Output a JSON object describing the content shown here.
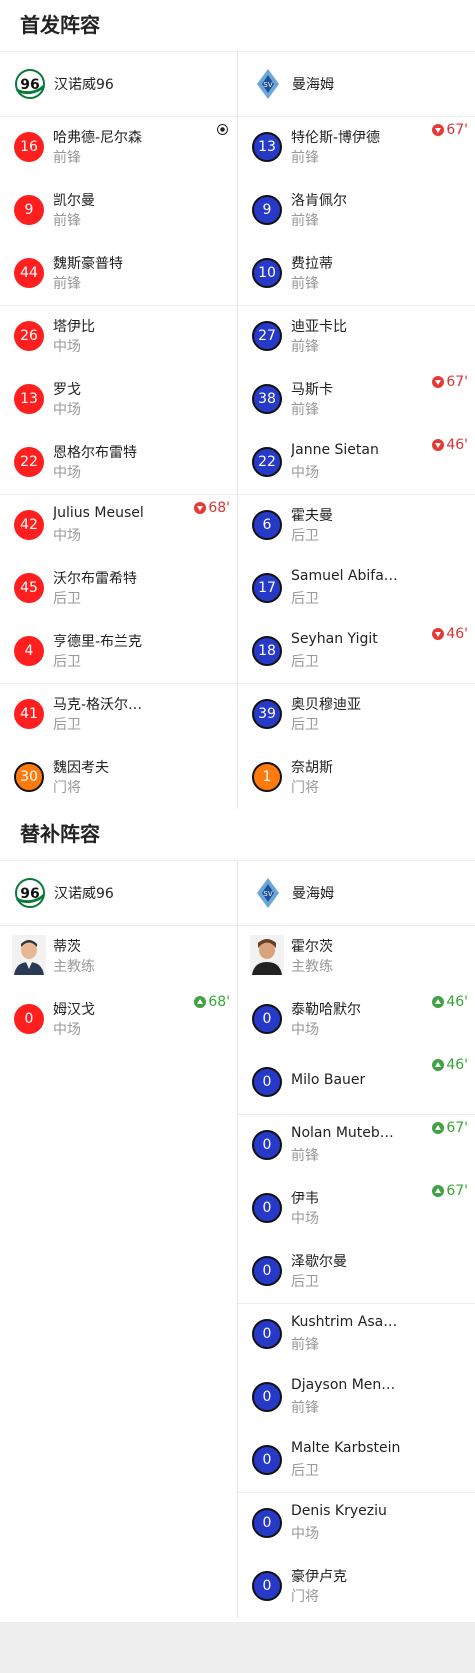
{
  "starting": {
    "title": "首发阵容",
    "home": {
      "name": "汉诺威96",
      "players": [
        {
          "num": "16",
          "name": "哈弗德-尼尔森",
          "pos": "前锋",
          "event": "goal",
          "min": ""
        },
        {
          "num": "9",
          "name": "凯尔曼",
          "pos": "前锋",
          "event": "",
          "min": ""
        },
        {
          "num": "44",
          "name": "魏斯豪普特",
          "pos": "前锋",
          "event": "",
          "min": ""
        },
        {
          "num": "26",
          "name": "塔伊比",
          "pos": "中场",
          "event": "",
          "min": ""
        },
        {
          "num": "13",
          "name": "罗戈",
          "pos": "中场",
          "event": "",
          "min": ""
        },
        {
          "num": "22",
          "name": "恩格尔布雷特",
          "pos": "中场",
          "event": "",
          "min": ""
        },
        {
          "num": "42",
          "name": "Julius Meusel",
          "pos": "中场",
          "event": "out",
          "min": "68'"
        },
        {
          "num": "45",
          "name": "沃尔布雷希特",
          "pos": "后卫",
          "event": "",
          "min": ""
        },
        {
          "num": "4",
          "name": "亨德里-布兰克",
          "pos": "后卫",
          "event": "",
          "min": ""
        },
        {
          "num": "41",
          "name": "马克-格沃尔…",
          "pos": "后卫",
          "event": "",
          "min": ""
        },
        {
          "num": "30",
          "name": "魏因考夫",
          "pos": "门将",
          "event": "",
          "min": ""
        }
      ]
    },
    "away": {
      "name": "曼海姆",
      "players": [
        {
          "num": "13",
          "name": "特伦斯-博伊德",
          "pos": "前锋",
          "event": "out",
          "min": "67'"
        },
        {
          "num": "9",
          "name": "洛肯佩尔",
          "pos": "前锋",
          "event": "",
          "min": ""
        },
        {
          "num": "10",
          "name": "费拉蒂",
          "pos": "前锋",
          "event": "",
          "min": ""
        },
        {
          "num": "27",
          "name": "迪亚卡比",
          "pos": "前锋",
          "event": "",
          "min": ""
        },
        {
          "num": "38",
          "name": "马斯卡",
          "pos": "前锋",
          "event": "out",
          "min": "67'"
        },
        {
          "num": "22",
          "name": "Janne Sietan",
          "pos": "中场",
          "event": "out",
          "min": "46'"
        },
        {
          "num": "6",
          "name": "霍夫曼",
          "pos": "后卫",
          "event": "",
          "min": ""
        },
        {
          "num": "17",
          "name": "Samuel Abifade",
          "pos": "后卫",
          "event": "",
          "min": ""
        },
        {
          "num": "18",
          "name": "Seyhan Yigit",
          "pos": "后卫",
          "event": "out",
          "min": "46'"
        },
        {
          "num": "39",
          "name": "奥贝穆迪亚",
          "pos": "后卫",
          "event": "",
          "min": ""
        },
        {
          "num": "1",
          "name": "奈胡斯",
          "pos": "门将",
          "event": "",
          "min": ""
        }
      ]
    }
  },
  "subs": {
    "title": "替补阵容",
    "home": {
      "name": "汉诺威96",
      "coach": {
        "name": "蒂茨",
        "role": "主教练"
      },
      "players": [
        {
          "num": "0",
          "name": "姆汉戈",
          "pos": "中场",
          "event": "in",
          "min": "68'"
        }
      ]
    },
    "away": {
      "name": "曼海姆",
      "coach": {
        "name": "霍尔茨",
        "role": "主教练"
      },
      "players": [
        {
          "num": "0",
          "name": "泰勒哈默尔",
          "pos": "中场",
          "event": "in",
          "min": "46'"
        },
        {
          "num": "0",
          "name": "Milo Bauer",
          "pos": "",
          "event": "in",
          "min": "46'"
        },
        {
          "num": "0",
          "name": "Nolan Muteba…",
          "pos": "前锋",
          "event": "in",
          "min": "67'"
        },
        {
          "num": "0",
          "name": "伊韦",
          "pos": "中场",
          "event": "in",
          "min": "67'"
        },
        {
          "num": "0",
          "name": "泽歇尔曼",
          "pos": "后卫",
          "event": "",
          "min": ""
        },
        {
          "num": "0",
          "name": "Kushtrim Asal…",
          "pos": "前锋",
          "event": "",
          "min": ""
        },
        {
          "num": "0",
          "name": "Djayson Men…",
          "pos": "前锋",
          "event": "",
          "min": ""
        },
        {
          "num": "0",
          "name": "Malte Karbstein",
          "pos": "后卫",
          "event": "",
          "min": ""
        },
        {
          "num": "0",
          "name": "Denis Kryeziu",
          "pos": "中场",
          "event": "",
          "min": ""
        },
        {
          "num": "0",
          "name": "豪伊卢克",
          "pos": "门将",
          "event": "",
          "min": ""
        }
      ]
    }
  },
  "colors": {
    "home_num": "#ff1f1f",
    "away_num": "#2639c7",
    "keeper_home": "#ff7a0d",
    "keeper_away": "#ff7a0d",
    "sub_out": "#e53935",
    "sub_in": "#43a047"
  },
  "icons": {
    "home_logo": "hannover96-logo",
    "away_logo": "waldhof-mannheim-logo",
    "goal": "football-icon",
    "sub_out": "sub-out-arrow-icon",
    "sub_in": "sub-in-arrow-icon"
  }
}
